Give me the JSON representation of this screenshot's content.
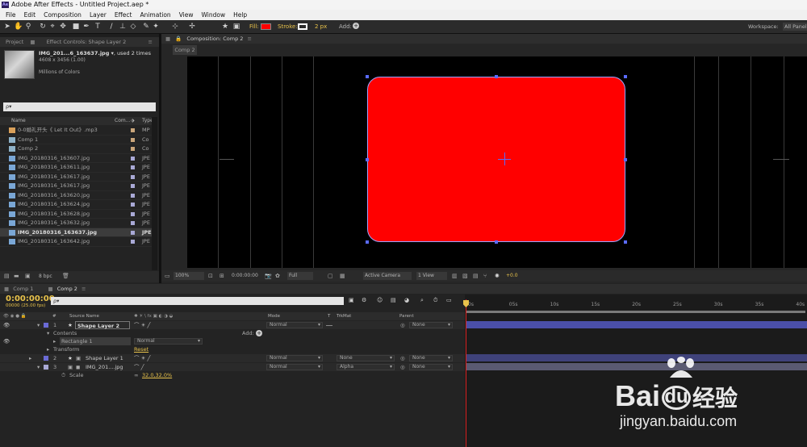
{
  "app": {
    "title": "Adobe After Effects - Untitled Project.aep *",
    "icon": "Ae"
  },
  "menu": [
    "File",
    "Edit",
    "Composition",
    "Layer",
    "Effect",
    "Animation",
    "View",
    "Window",
    "Help"
  ],
  "toolbar": {
    "fill_label": "Fill:",
    "stroke_label": "Stroke:",
    "stroke_width": "2 px",
    "add_label": "Add:",
    "workspace_label": "Workspace:",
    "workspace_value": "All Panels",
    "fill_color": "#ff0000"
  },
  "project_panel": {
    "tab_project": "Project",
    "tab_effect": "Effect Controls: Shape Layer 2",
    "selected_name": "IMG_201...6_163637.jpg ▾",
    "selected_used": ", used 2 times",
    "selected_dims": "4608 x 3456 (1.00)",
    "selected_colors": "Millions of Colors",
    "search_placeholder": "ρ▾",
    "col_name": "Name",
    "col_comment": "Com...",
    "col_type": "Type",
    "items": [
      {
        "name": "0-0婚礼开头《 Let It Out》.mp3",
        "type": "MP",
        "icon": "audio",
        "label": "#c9a57a"
      },
      {
        "name": "Comp 1",
        "type": "Co",
        "icon": "comp",
        "label": "#c9a57a"
      },
      {
        "name": "Comp 2",
        "type": "Co",
        "icon": "comp",
        "label": "#c9a57a"
      },
      {
        "name": "IMG_20180316_163607.jpg",
        "type": "JPE",
        "icon": "image",
        "label": "#a9a9d6"
      },
      {
        "name": "IMG_20180316_163611.jpg",
        "type": "JPE",
        "icon": "image",
        "label": "#a9a9d6"
      },
      {
        "name": "IMG_20180316_163617.jpg",
        "type": "JPE",
        "icon": "image",
        "label": "#a9a9d6"
      },
      {
        "name": "IMG_20180316_163617.jpg",
        "type": "JPE",
        "icon": "image",
        "label": "#a9a9d6"
      },
      {
        "name": "IMG_20180316_163620.jpg",
        "type": "JPE",
        "icon": "image",
        "label": "#a9a9d6"
      },
      {
        "name": "IMG_20180316_163624.jpg",
        "type": "JPE",
        "icon": "image",
        "label": "#a9a9d6"
      },
      {
        "name": "IMG_20180316_163628.jpg",
        "type": "JPE",
        "icon": "image",
        "label": "#a9a9d6"
      },
      {
        "name": "IMG_20180316_163632.jpg",
        "type": "JPE",
        "icon": "image",
        "label": "#a9a9d6"
      },
      {
        "name": "IMG_20180316_163637.jpg",
        "type": "JPE",
        "icon": "image",
        "label": "#a9a9d6",
        "selected": true
      },
      {
        "name": "IMG_20180316_163642.jpg",
        "type": "JPE",
        "icon": "image",
        "label": "#a9a9d6"
      }
    ],
    "bpc": "8 bpc"
  },
  "composition": {
    "tab": "Composition: Comp 2",
    "subtab": "Comp 2",
    "zoom": "100%",
    "timecode": "0:00:00:00",
    "resolution": "Full",
    "camera": "Active Camera",
    "views": "1 View",
    "exposure": "+0.0"
  },
  "timeline": {
    "tabs": [
      "Comp 1",
      "Comp 2"
    ],
    "timecode": "0:00:00:00",
    "fps": "00000 (25.00 fps)",
    "search_placeholder": "ρ▾",
    "col_hash": "#",
    "col_source": "Source Name",
    "col_mode": "Mode",
    "col_t": "T",
    "col_trkmat": "TrkMat",
    "col_parent": "Parent",
    "ruler": [
      "0s",
      "05s",
      "10s",
      "15s",
      "20s",
      "25s",
      "30s",
      "35s",
      "40s"
    ],
    "layers": [
      {
        "num": "1",
        "name": "Shape Layer 2",
        "mode": "Normal",
        "trkmat": "",
        "parent": "None",
        "color": "#6b6bd6"
      },
      {
        "num": "2",
        "name": "Shape Layer 1",
        "mode": "Normal",
        "trkmat": "None",
        "parent": "None",
        "color": "#6b6bd6"
      },
      {
        "num": "3",
        "name": "IMG_201....jpg",
        "mode": "Normal",
        "trkmat": "Alpha",
        "parent": "None",
        "color": "#a9a9d6"
      }
    ],
    "contents_label": "Contents",
    "add_label": "Add:",
    "rect_label": "Rectangle 1",
    "rect_mode": "Normal",
    "transform_label": "Transform",
    "reset_label": "Reset",
    "scale_label": "Scale",
    "scale_value": "32.0,32.0%"
  },
  "watermark": {
    "brand": "Bai",
    "brand2": "du",
    "cn": "经验",
    "url": "jingyan.baidu.com"
  }
}
